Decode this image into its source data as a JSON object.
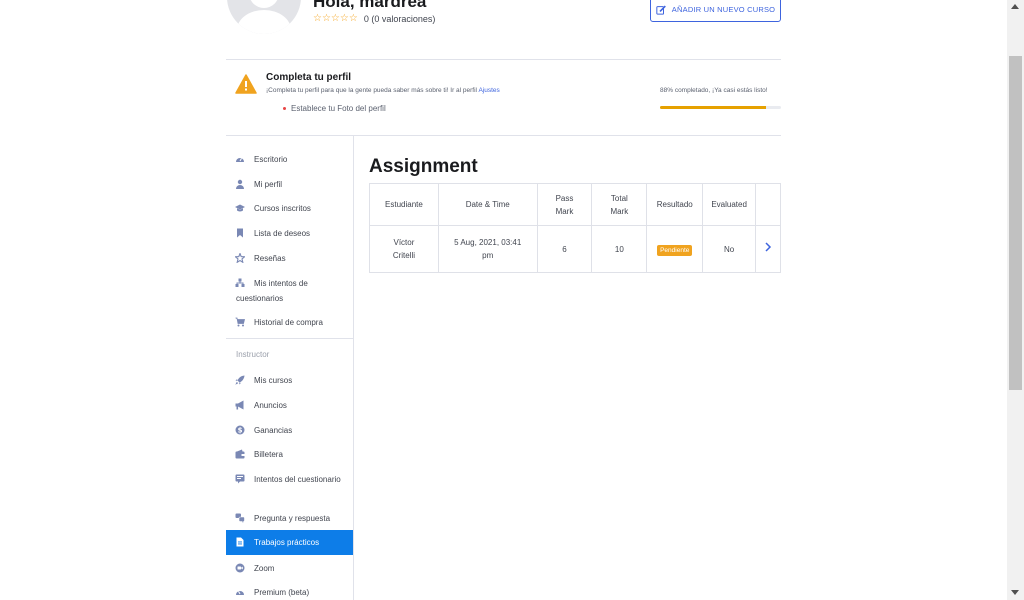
{
  "header": {
    "greeting": "Hola, mardrea",
    "rating_stars": "☆☆☆☆☆",
    "rating_text": "0 (0 valoraciones)",
    "add_course_label": "AÑADIR UN NUEVO CURSO"
  },
  "profile_completion": {
    "title": "Completa tu perfil",
    "description": "¡Completa tu perfil para que la gente pueda saber más sobre ti! Ir al perfil",
    "settings_link": "Ajustes",
    "task": "Establece tu Foto del perfil",
    "progress_text": "88% completado, ¡Ya casi estás listo!",
    "progress_value": 0.88,
    "accent_color": "#e6a100"
  },
  "sidebar": {
    "items": [
      {
        "label": "Escritorio",
        "icon": "dashboard-icon"
      },
      {
        "label": "Mi perfil",
        "icon": "user-icon"
      },
      {
        "label": "Cursos inscritos",
        "icon": "graduation-cap-icon"
      },
      {
        "label": "Lista de deseos",
        "icon": "bookmark-icon"
      },
      {
        "label": "Reseñas",
        "icon": "star-icon"
      },
      {
        "label": "Mis intentos de cuestionarios",
        "icon": "quiz-attempts-icon"
      },
      {
        "label": "Historial de compra",
        "icon": "cart-icon"
      }
    ],
    "instructor_label": "Instructor",
    "instructor_items": [
      {
        "label": "Mis cursos",
        "icon": "rocket-icon"
      },
      {
        "label": "Anuncios",
        "icon": "megaphone-icon"
      },
      {
        "label": "Ganancias",
        "icon": "coin-icon"
      },
      {
        "label": "Billetera",
        "icon": "wallet-icon"
      },
      {
        "label": "Intentos del cuestionario",
        "icon": "quiz-icon"
      },
      {
        "label": "Pregunta y respuesta",
        "icon": "qa-icon"
      },
      {
        "label": "Trabajos prácticos",
        "icon": "assignment-icon",
        "active": true
      },
      {
        "label": "Zoom",
        "icon": "zoom-icon"
      },
      {
        "label": "Premium (beta)",
        "icon": "premium-icon"
      }
    ]
  },
  "main": {
    "title": "Assignment",
    "columns": [
      "Estudiante",
      "Date & Time",
      "Pass Mark",
      "Total Mark",
      "Resultado",
      "Evaluated",
      ""
    ],
    "rows": [
      {
        "student": "Víctor Critelli",
        "datetime": "5 Aug, 2021, 03:41 pm",
        "pass_mark": "6",
        "total_mark": "10",
        "result": "Pendiente",
        "evaluated": "No"
      }
    ]
  },
  "colors": {
    "brand": "#3e64de",
    "active_nav": "#0d7de8",
    "pending_badge": "#f0a31f"
  }
}
